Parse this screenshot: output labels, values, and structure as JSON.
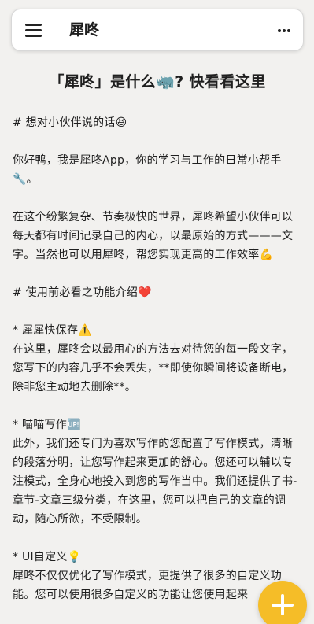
{
  "header": {
    "title": "犀咚",
    "menu_icon": "hamburger-menu-icon",
    "more_icon": "more-dots-icon"
  },
  "article": {
    "title": "「犀咚」是什么🦏? 快看看这里",
    "heading_1": "# 想对小伙伴说的话😆",
    "paragraph_1": "你好鸭，我是犀咚App，你的学习与工作的日常小帮手🔧。",
    "paragraph_2": "在这个纷繁复杂、节奏极快的世界，犀咚希望小伙伴可以每天都有时间记录自己的内心，以最原始的方式———文字。当然也可以用犀咚，帮您实现更高的工作效率💪",
    "heading_2": "# 使用前必看之功能介绍❤️",
    "feature_1_title": "* 犀犀快保存⚠️",
    "feature_1_body": "在这里，犀咚会以最用心的方法去对待您的每一段文字，您写下的内容几乎不会丢失，**即使你瞬间将设备断电，除非您主动地去删除**。",
    "feature_2_title": "* 喵喵写作🆙",
    "feature_2_body": "此外，我们还专门为喜欢写作的您配置了写作模式，清晰的段落分明，让您写作起来更加的舒心。您还可以辅以专注模式，全身心地投入到您的写作当中。我们还提供了书-章节-文章三级分类，在这里，您可以把自己的文章的调动，随心所欲，不受限制。",
    "feature_3_title": "* UI自定义💡",
    "feature_3_body": "犀咚不仅仅优化了写作模式，更提供了很多的自定义功能。您可以使用很多自定义的功能让您使用起来"
  },
  "fab": {
    "icon": "add-plus-icon",
    "color": "#f5bd28"
  },
  "colors": {
    "background": "#f2f1ef",
    "text": "#1f1f1f",
    "topbar": "#ffffff"
  }
}
